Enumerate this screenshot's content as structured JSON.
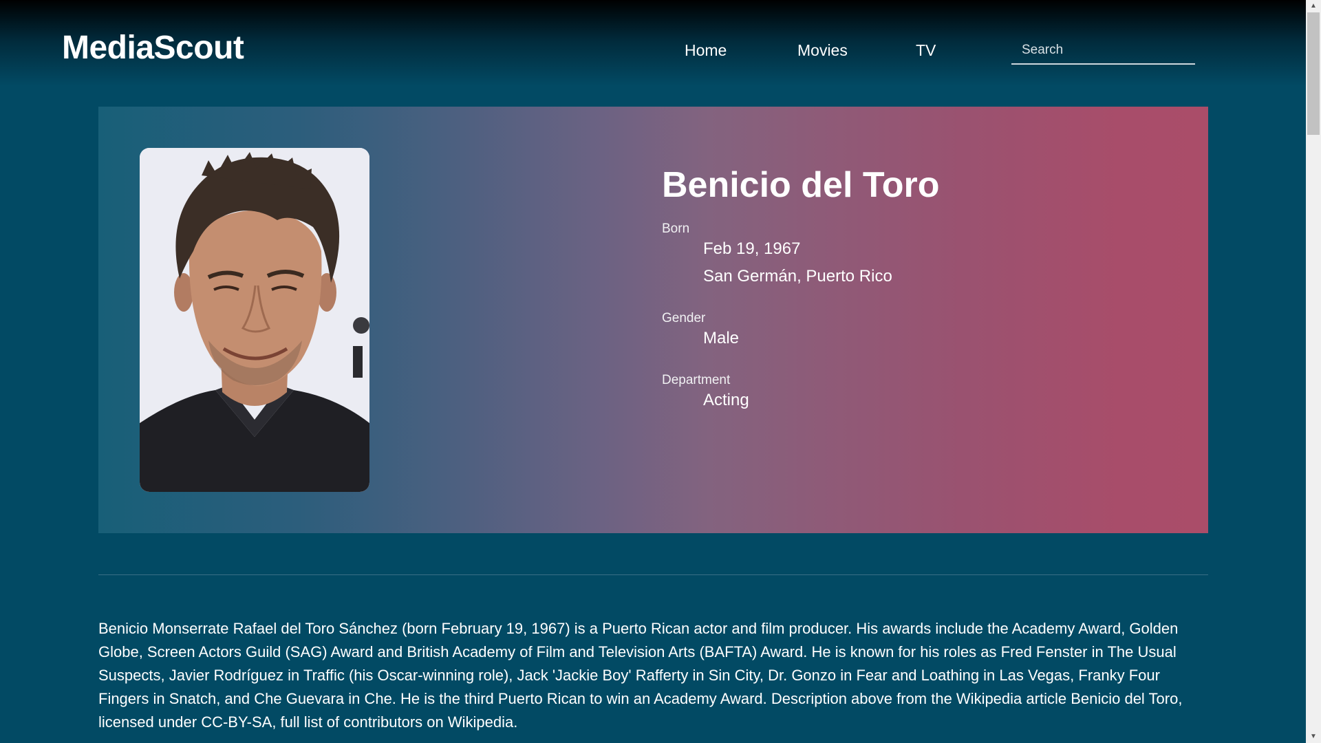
{
  "header": {
    "logo": "MediaScout",
    "nav": {
      "home": "Home",
      "movies": "Movies",
      "tv": "TV"
    },
    "search": {
      "placeholder": "Search",
      "value": ""
    }
  },
  "person": {
    "name": "Benicio del Toro",
    "born_label": "Born",
    "born_date": "Feb 19, 1967",
    "born_place": "San Germán, Puerto Rico",
    "gender_label": "Gender",
    "gender": "Male",
    "department_label": "Department",
    "department": "Acting",
    "biography": "Benicio Monserrate Rafael del Toro Sánchez (born February 19, 1967) is a Puerto Rican actor and film producer. His awards include the Academy Award, Golden Globe, Screen Actors Guild (SAG) Award and British Academy of Film and Television Arts (BAFTA) Award. He is known for his roles as Fred Fenster in The Usual Suspects, Javier Rodríguez in Traffic (his Oscar-winning role), Jack 'Jackie Boy' Rafferty in Sin City, Dr. Gonzo in Fear and Loathing in Las Vegas, Franky Four Fingers in Snatch, and Che Guevara in Che. He is the third Puerto Rican to win an Academy Award. Description above from the Wikipedia article Benicio del Toro, licensed under CC-BY-SA, full list of contributors on Wikipedia."
  },
  "scrollbar": {
    "up_icon": "chevron-up-icon",
    "down_icon": "chevron-down-icon"
  },
  "colors": {
    "background": "#024a64",
    "hero_gradient_start": "#185f78",
    "hero_gradient_end": "#aa4d69"
  }
}
